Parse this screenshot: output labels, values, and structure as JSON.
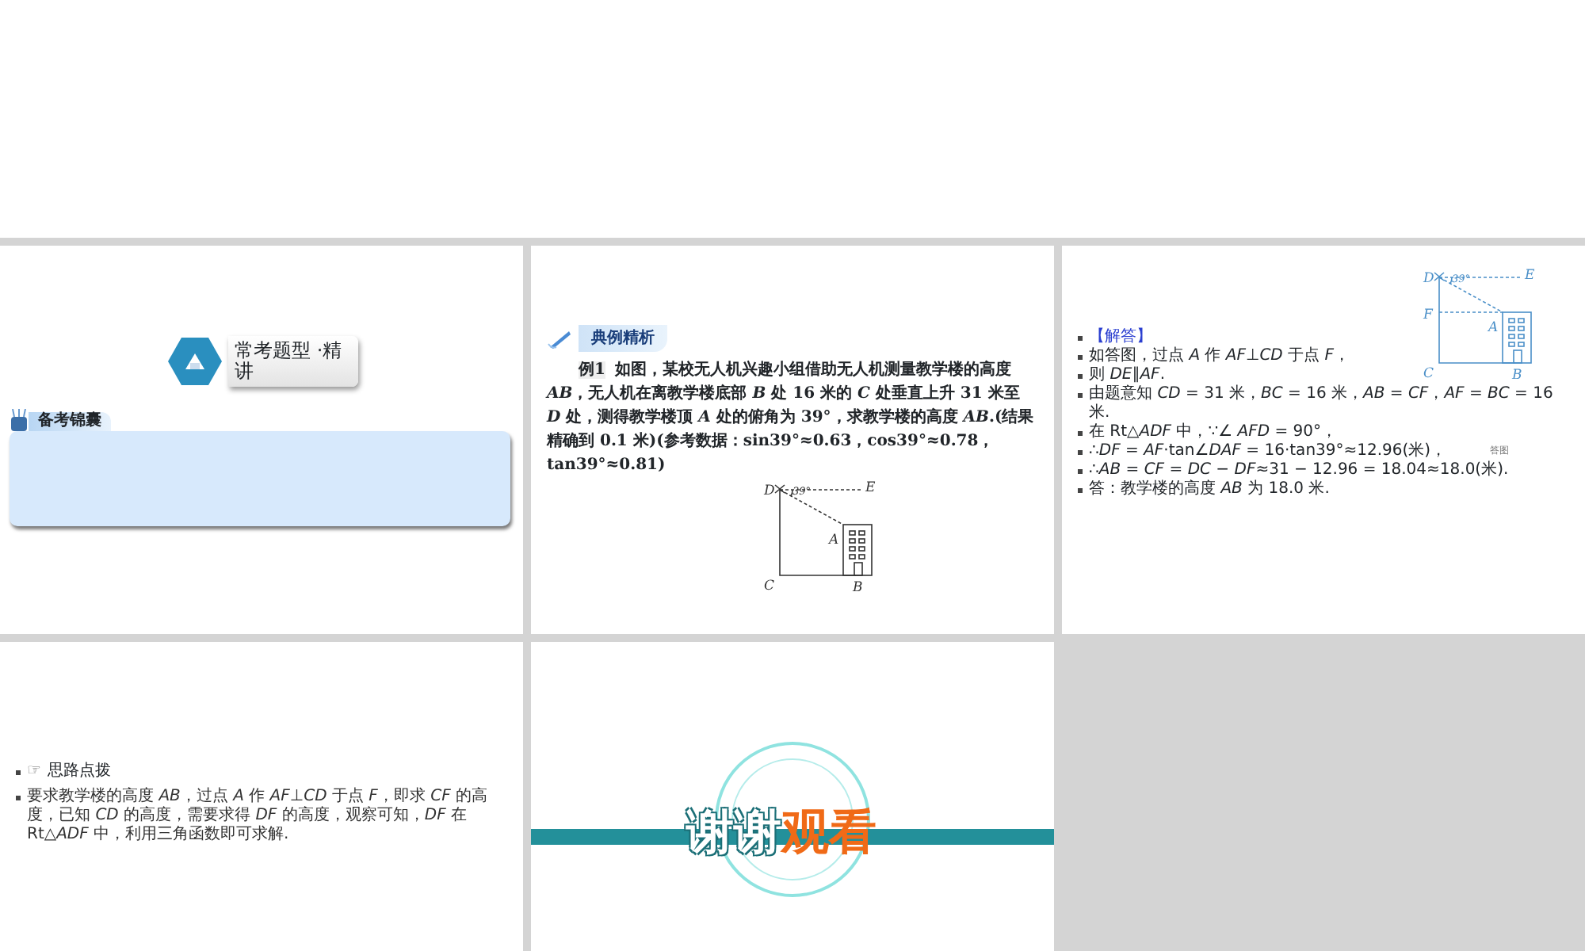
{
  "slides": [
    {
      "kind": "title",
      "heading": "常考题型 ·精讲",
      "box_label": "备考锦囊"
    },
    {
      "kind": "example",
      "banner": "典例精析",
      "tag": "例1",
      "text": "如图，某校无人机兴趣小组借助无人机测量教学楼的高度 *AB*，无人机在离教学楼底部 *B* 处 16 米的 *C* 处垂直上升 31 米至 *D* 处，测得教学楼顶 *A* 处的俯角为 39°，求教学楼的高度 *AB*.(结果精确到 0.1 米)(参考数据：sin39°≈0.63，cos39°≈0.78，tan39°≈0.81)",
      "diagram_labels": [
        "D",
        "39°",
        "E",
        "A",
        "C",
        "B"
      ]
    },
    {
      "kind": "answer",
      "heading": "【解答】",
      "lines": [
        "如答图，过点 *A* 作 *AF*⊥*CD* 于点 *F*，",
        "则 *DE*∥*AF*.",
        "由题意知 *CD* = 31 米，*BC* = 16 米，*AB* = *CF*，*AF* = *BC* = 16 米.",
        "在 Rt△*ADF* 中，∵∠ *AFD* = 90°，",
        "∴*DF* = *AF*·tan∠*DAF* = 16·tan39°≈12.96(米)，",
        "∴*AB* = *CF* = *DC* − *DF*≈31 − 12.96 = 18.04≈18.0(米).",
        "答：教学楼的高度 *AB* 为 18.0 米."
      ],
      "caption": "答图",
      "diagram_labels": [
        "D",
        "39°",
        "E",
        "A",
        "C",
        "B",
        "F"
      ]
    },
    {
      "kind": "hint",
      "hint_icon": "☞",
      "heading": "思路点拨",
      "text": "要求教学楼的高度 *AB*，过点 *A* 作 *AF*⊥*CD* 于点 *F*，即求 *CF* 的高度，已知 *CD* 的高度，需要求得 *DF* 的高度，观察可知，*DF* 在 Rt△*ADF* 中，利用三角函数即可求解."
    },
    {
      "kind": "closing",
      "words": [
        "谢谢",
        "观看"
      ]
    }
  ]
}
